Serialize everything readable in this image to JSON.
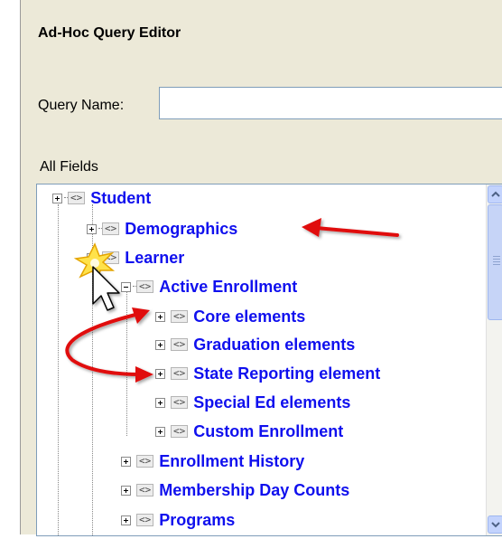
{
  "window": {
    "title": "Ad-Hoc Query Editor"
  },
  "query": {
    "label": "Query Name:",
    "value": ""
  },
  "fields": {
    "label": "All Fields"
  },
  "tree": {
    "node_icon": "<>",
    "items": [
      {
        "label": "Student",
        "toggle": "plus"
      },
      {
        "label": "Demographics",
        "toggle": "plus"
      },
      {
        "label": "Learner",
        "toggle": "minus"
      },
      {
        "label": "Active Enrollment",
        "toggle": "minus"
      },
      {
        "label": "Core elements",
        "toggle": "plus"
      },
      {
        "label": "Graduation elements",
        "toggle": "plus"
      },
      {
        "label": "State Reporting element",
        "toggle": "plus"
      },
      {
        "label": "Special Ed elements",
        "toggle": "plus"
      },
      {
        "label": "Custom Enrollment",
        "toggle": "plus"
      },
      {
        "label": "Enrollment History",
        "toggle": "plus"
      },
      {
        "label": "Membership Day Counts",
        "toggle": "plus"
      },
      {
        "label": "Programs",
        "toggle": "plus"
      }
    ]
  },
  "icons": {
    "scroll_up": "chevron-up-icon",
    "scroll_down": "chevron-down-icon",
    "cursor": "mouse-pointer-icon",
    "click_highlight": "click-burst-icon",
    "annotation": "red-arrow-icon"
  },
  "colors": {
    "link": "#1010ee",
    "arrow": "#e01010",
    "panel": "#ece9d8",
    "scrollbar": "#c3d3fd"
  }
}
